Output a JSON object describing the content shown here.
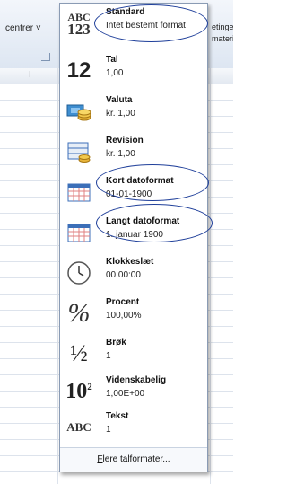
{
  "ribbon": {
    "center_button": "centrer ˅",
    "right_text_line1": "etinge",
    "right_text_line2": "materin"
  },
  "sheet": {
    "column_label": "I"
  },
  "number_formats": [
    {
      "name": "Standard",
      "sample": "Intet bestemt format",
      "icon": "abc-123-icon",
      "icon_top": "ABC",
      "icon_bottom": "123"
    },
    {
      "name": "Tal",
      "sample": "1,00",
      "icon": "number-12-icon",
      "icon_text": "12"
    },
    {
      "name": "Valuta",
      "sample": "kr. 1,00",
      "icon": "currency-icon"
    },
    {
      "name": "Revision",
      "sample": "kr. 1,00",
      "icon": "accounting-icon"
    },
    {
      "name": "Kort datoformat",
      "sample": "01-01-1900",
      "icon": "calendar-icon"
    },
    {
      "name": "Langt datoformat",
      "sample": "1. januar 1900",
      "icon": "calendar-icon"
    },
    {
      "name": "Klokkeslæt",
      "sample": "00:00:00",
      "icon": "clock-icon"
    },
    {
      "name": "Procent",
      "sample": "100,00%",
      "icon": "percent-icon",
      "icon_text": "%"
    },
    {
      "name": "Brøk",
      "sample": "1",
      "icon": "fraction-icon",
      "icon_text": "½"
    },
    {
      "name": "Videnskabelig",
      "sample": "1,00E+00",
      "icon": "scientific-icon",
      "icon_text": "10",
      "icon_sup": "2"
    },
    {
      "name": "Tekst",
      "sample": "1",
      "icon": "text-abc-icon",
      "icon_text": "ABC"
    }
  ],
  "footer": {
    "more_formats_first": "F",
    "more_formats_rest": "lere talformater..."
  },
  "colors": {
    "highlight_oval": "#1f3f9a",
    "ribbon_bg": "#dde6f2",
    "calendar_blue": "#3c6fb8",
    "currency_gold": "#e8b53a"
  }
}
